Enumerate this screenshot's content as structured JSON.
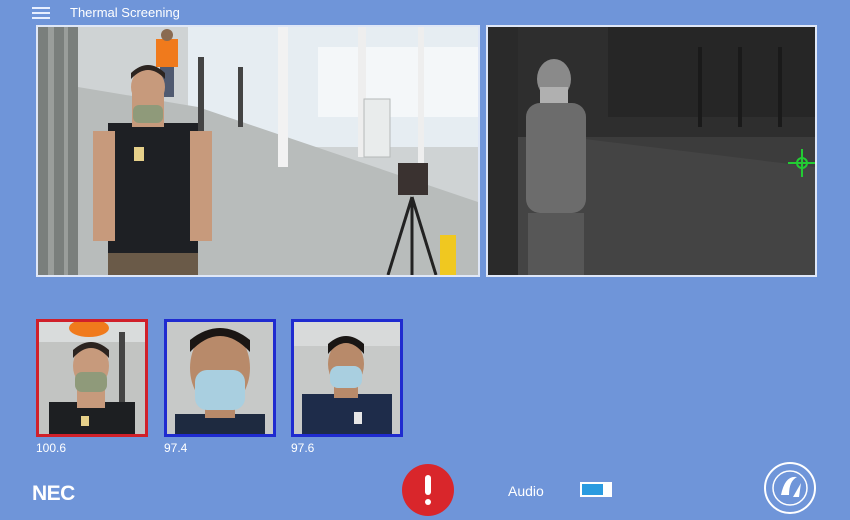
{
  "app": {
    "title": "Thermal Screening"
  },
  "feeds": {
    "rgb": {
      "name": "rgb-camera-feed"
    },
    "thermal": {
      "name": "thermal-camera-feed",
      "target_color": "#22cc33"
    }
  },
  "thumbnails": [
    {
      "temperature": "100.6",
      "status": "alert",
      "border_color": "#d0202a"
    },
    {
      "temperature": "97.4",
      "status": "normal",
      "border_color": "#1f2bd0"
    },
    {
      "temperature": "97.6",
      "status": "normal",
      "border_color": "#1f2bd0"
    }
  ],
  "footer": {
    "brand": "NEC",
    "alert_icon": "exclamation-icon",
    "alert_color": "#d9262b",
    "audio_label": "Audio",
    "audio_toggle_color": "#2a9be0"
  },
  "colors": {
    "background": "#6f95d9",
    "text": "#ffffff"
  }
}
